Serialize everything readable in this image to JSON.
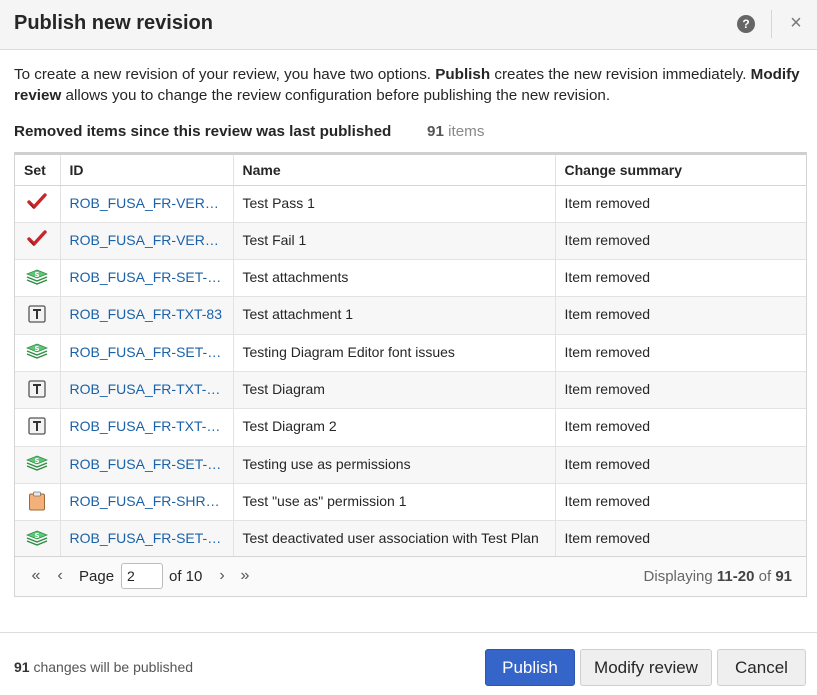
{
  "dialog": {
    "title": "Publish new revision",
    "help_icon": "?",
    "close_icon": "×"
  },
  "description": {
    "part1": "To create a new revision of your review, you have two options. ",
    "publish_bold": "Publish",
    "part2": " creates the new revision immediately. ",
    "modify_bold": "Modify review",
    "part3": " allows you to change the review configuration before publishing the new revision."
  },
  "section": {
    "title": "Removed items since this review was last published",
    "count": "91",
    "count_suffix": " items"
  },
  "table": {
    "headers": {
      "set": "Set",
      "id": "ID",
      "name": "Name",
      "summary": "Change summary"
    },
    "rows": [
      {
        "icon": "red-check-icon",
        "id": "ROB_FUSA_FR-VER-…",
        "name": "Test Pass 1",
        "summary": "Item removed"
      },
      {
        "icon": "red-check-icon",
        "id": "ROB_FUSA_FR-VER-…",
        "name": "Test Fail 1",
        "summary": "Item removed"
      },
      {
        "icon": "test-set-icon",
        "id": "ROB_FUSA_FR-SET-…",
        "name": "Test attachments",
        "summary": "Item removed"
      },
      {
        "icon": "text-item-icon",
        "id": "ROB_FUSA_FR-TXT-83",
        "name": "Test attachment 1",
        "summary": "Item removed"
      },
      {
        "icon": "test-set-icon",
        "id": "ROB_FUSA_FR-SET-…",
        "name": "Testing Diagram Editor font issues",
        "summary": "Item removed"
      },
      {
        "icon": "text-item-icon",
        "id": "ROB_FUSA_FR-TXT-…",
        "name": "Test Diagram",
        "summary": "Item removed"
      },
      {
        "icon": "text-item-icon",
        "id": "ROB_FUSA_FR-TXT-…",
        "name": "Test Diagram 2",
        "summary": "Item removed"
      },
      {
        "icon": "test-set-icon",
        "id": "ROB_FUSA_FR-SET-…",
        "name": "Testing use as permissions",
        "summary": "Item removed"
      },
      {
        "icon": "clipboard-icon",
        "id": "ROB_FUSA_FR-SHR-…",
        "name": "Test \"use as\" permission 1",
        "summary": "Item removed"
      },
      {
        "icon": "test-set-icon",
        "id": "ROB_FUSA_FR-SET-…",
        "name": "Test deactivated user association with Test Plan",
        "summary": "Item removed"
      }
    ]
  },
  "pager": {
    "page_label": "Page",
    "page_value": "2",
    "of_label": "of 10",
    "display_prefix": "Displaying ",
    "display_range": "11-20",
    "display_of": " of ",
    "display_total": "91"
  },
  "footer": {
    "count": "91",
    "text": " changes will be published",
    "publish_label": "Publish",
    "modify_label": "Modify review",
    "cancel_label": "Cancel"
  },
  "colors": {
    "primary_button": "#3565c8",
    "link": "#1a61a9",
    "check_red": "#c8262b",
    "set_green": "#3fae58",
    "clipboard_orange": "#f3b179"
  }
}
